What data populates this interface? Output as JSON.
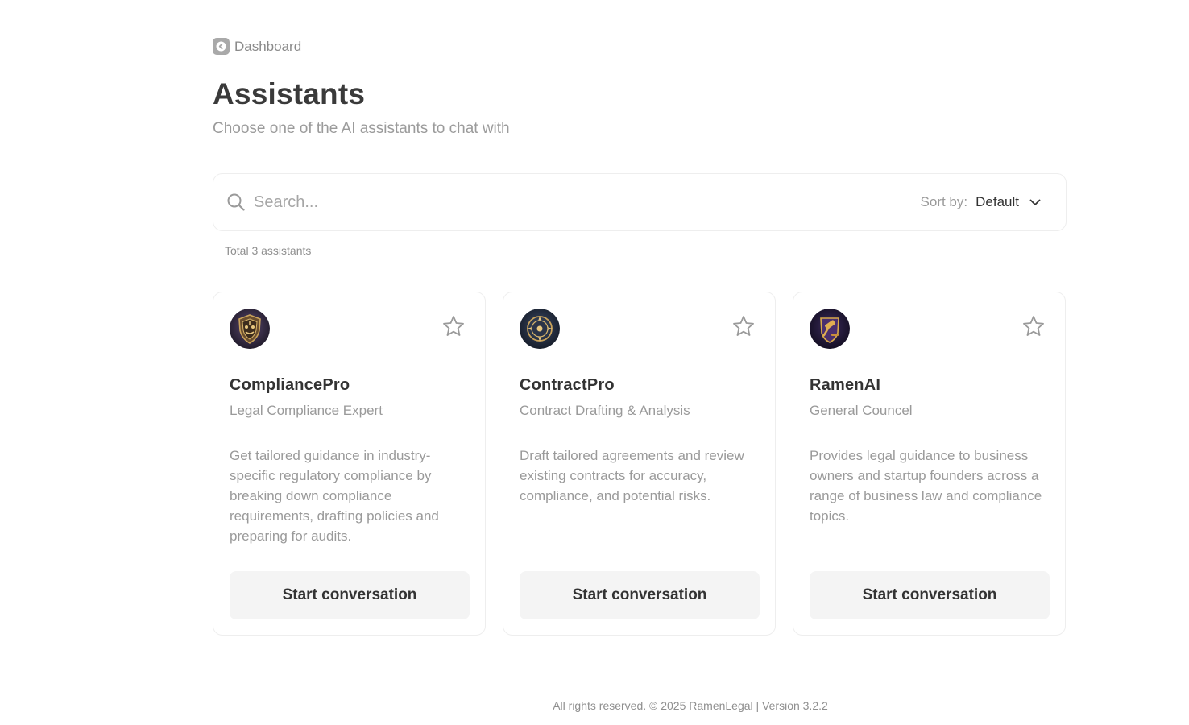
{
  "nav": {
    "back_label": "Dashboard",
    "back_icon": "arrow-left-circle-icon"
  },
  "header": {
    "title": "Assistants",
    "subtitle": "Choose one of the AI assistants to chat with"
  },
  "search": {
    "placeholder": "Search...",
    "value": "",
    "sort_label": "Sort by:",
    "sort_value": "Default"
  },
  "summary": {
    "total_text": "Total 3 assistants"
  },
  "assistants": [
    {
      "name": "CompliancePro",
      "role": "Legal Compliance Expert",
      "description": "Get tailored guidance in industry-specific regulatory compliance by breaking down compliance requirements, drafting policies and preparing for audits.",
      "button_label": "Start conversation",
      "avatar_icon": "shield-emblem-icon"
    },
    {
      "name": "ContractPro",
      "role": "Contract Drafting & Analysis",
      "description": "Draft tailored agreements and review existing contracts for accuracy, compliance, and potential risks.",
      "button_label": "Start conversation",
      "avatar_icon": "compass-emblem-icon"
    },
    {
      "name": "RamenAI",
      "role": "General Councel",
      "description": "Provides legal guidance to business owners and startup founders across a range of business law and compliance topics.",
      "button_label": "Start conversation",
      "avatar_icon": "gavel-emblem-icon"
    }
  ],
  "footer": {
    "text": "All rights reserved. © 2025 RamenLegal | Version 3.2.2"
  },
  "colors": {
    "title": "#3a3a3a",
    "muted": "#9a9a9a",
    "button_bg": "#f4f4f4",
    "border": "#eeeeee"
  }
}
